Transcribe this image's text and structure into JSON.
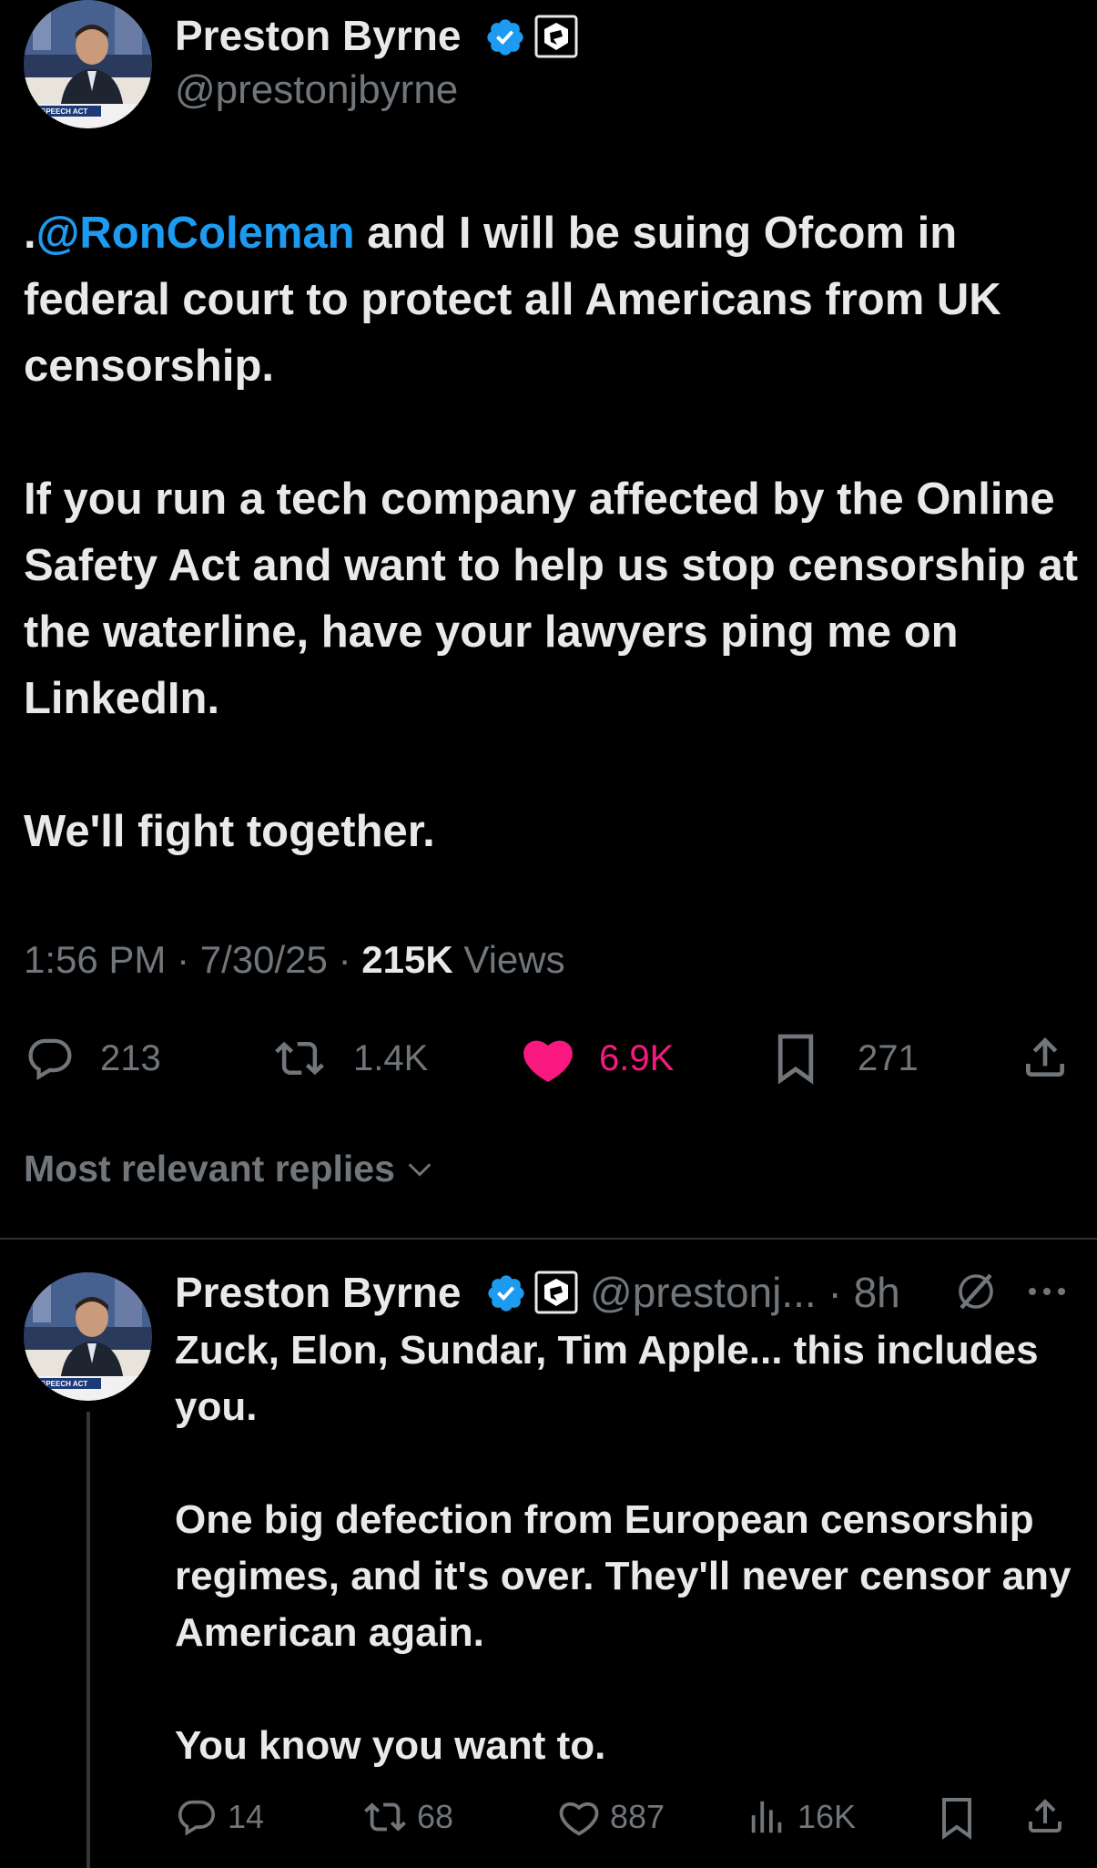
{
  "main_tweet": {
    "author_name": "Preston Byrne",
    "handle": "@prestonjbyrne",
    "avatar_caption": "SPEECH ACT",
    "text": {
      "mention": "@RonColeman",
      "p1_prefix": ".",
      "p1_rest": " and I will be suing Ofcom in federal court to protect all Americans from UK censorship.",
      "p2": "If you run a tech company affected by the Online Safety Act and want to help us stop censorship at the waterline, have your lawyers ping me on LinkedIn.",
      "p3": "We'll fight together."
    },
    "time": "1:56 PM",
    "date": "7/30/25",
    "separator": "·",
    "views_count": "215K",
    "views_label": "Views",
    "actions": {
      "replies": "213",
      "reposts": "1.4K",
      "likes": "6.9K",
      "bookmarks": "271"
    }
  },
  "replies_sort_label": "Most relevant replies",
  "reply": {
    "author_name": "Preston Byrne",
    "handle_time": "@prestonj... · 8h",
    "avatar_caption": "SPEECH ACT",
    "text": {
      "p1": "Zuck, Elon, Sundar, Tim Apple... this includes you.",
      "p2": "One big defection from European censorship regimes, and it's over. They'll never censor any American again.",
      "p3": "You know you want to."
    },
    "actions": {
      "replies": "14",
      "reposts": "68",
      "likes": "887",
      "views": "16K"
    }
  },
  "colors": {
    "background": "#000000",
    "text_primary": "#e7e9ea",
    "text_secondary": "#71767b",
    "link": "#1d9bf0",
    "like": "#f91880",
    "verified": "#1d9bf0"
  },
  "icons": [
    "verified-badge-icon",
    "affiliate-badge-icon",
    "reply-icon",
    "repost-icon",
    "like-icon",
    "bookmark-icon",
    "share-icon",
    "chevron-down-icon",
    "grok-icon",
    "more-icon",
    "views-icon"
  ]
}
